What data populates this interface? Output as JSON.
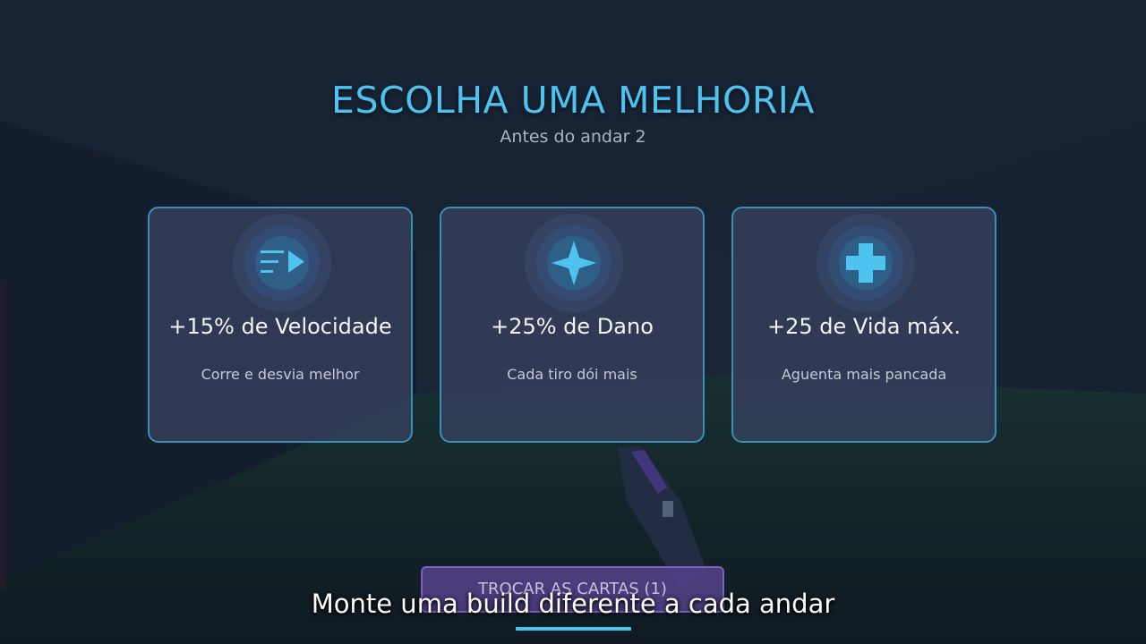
{
  "header": {
    "title": "ESCOLHA UMA MELHORIA",
    "subtitle": "Antes do andar 2"
  },
  "cards": [
    {
      "name": "+15% de Velocidade",
      "description": "Corre e desvia melhor",
      "icon": "speed-arrow-icon"
    },
    {
      "name": "+25% de Dano",
      "description": "Cada tiro dói mais",
      "icon": "damage-star-icon"
    },
    {
      "name": "+25 de Vida máx.",
      "description": "Aguenta mais pancada",
      "icon": "health-cross-icon"
    }
  ],
  "reroll_button": {
    "label": "TROCAR AS CARTAS (1)"
  },
  "caption": {
    "text": "Monte uma build diferente a cada andar"
  },
  "colors": {
    "accent": "#4fc3f0",
    "card_border": "#3a8fb5",
    "reroll_bg": "#56428c"
  }
}
